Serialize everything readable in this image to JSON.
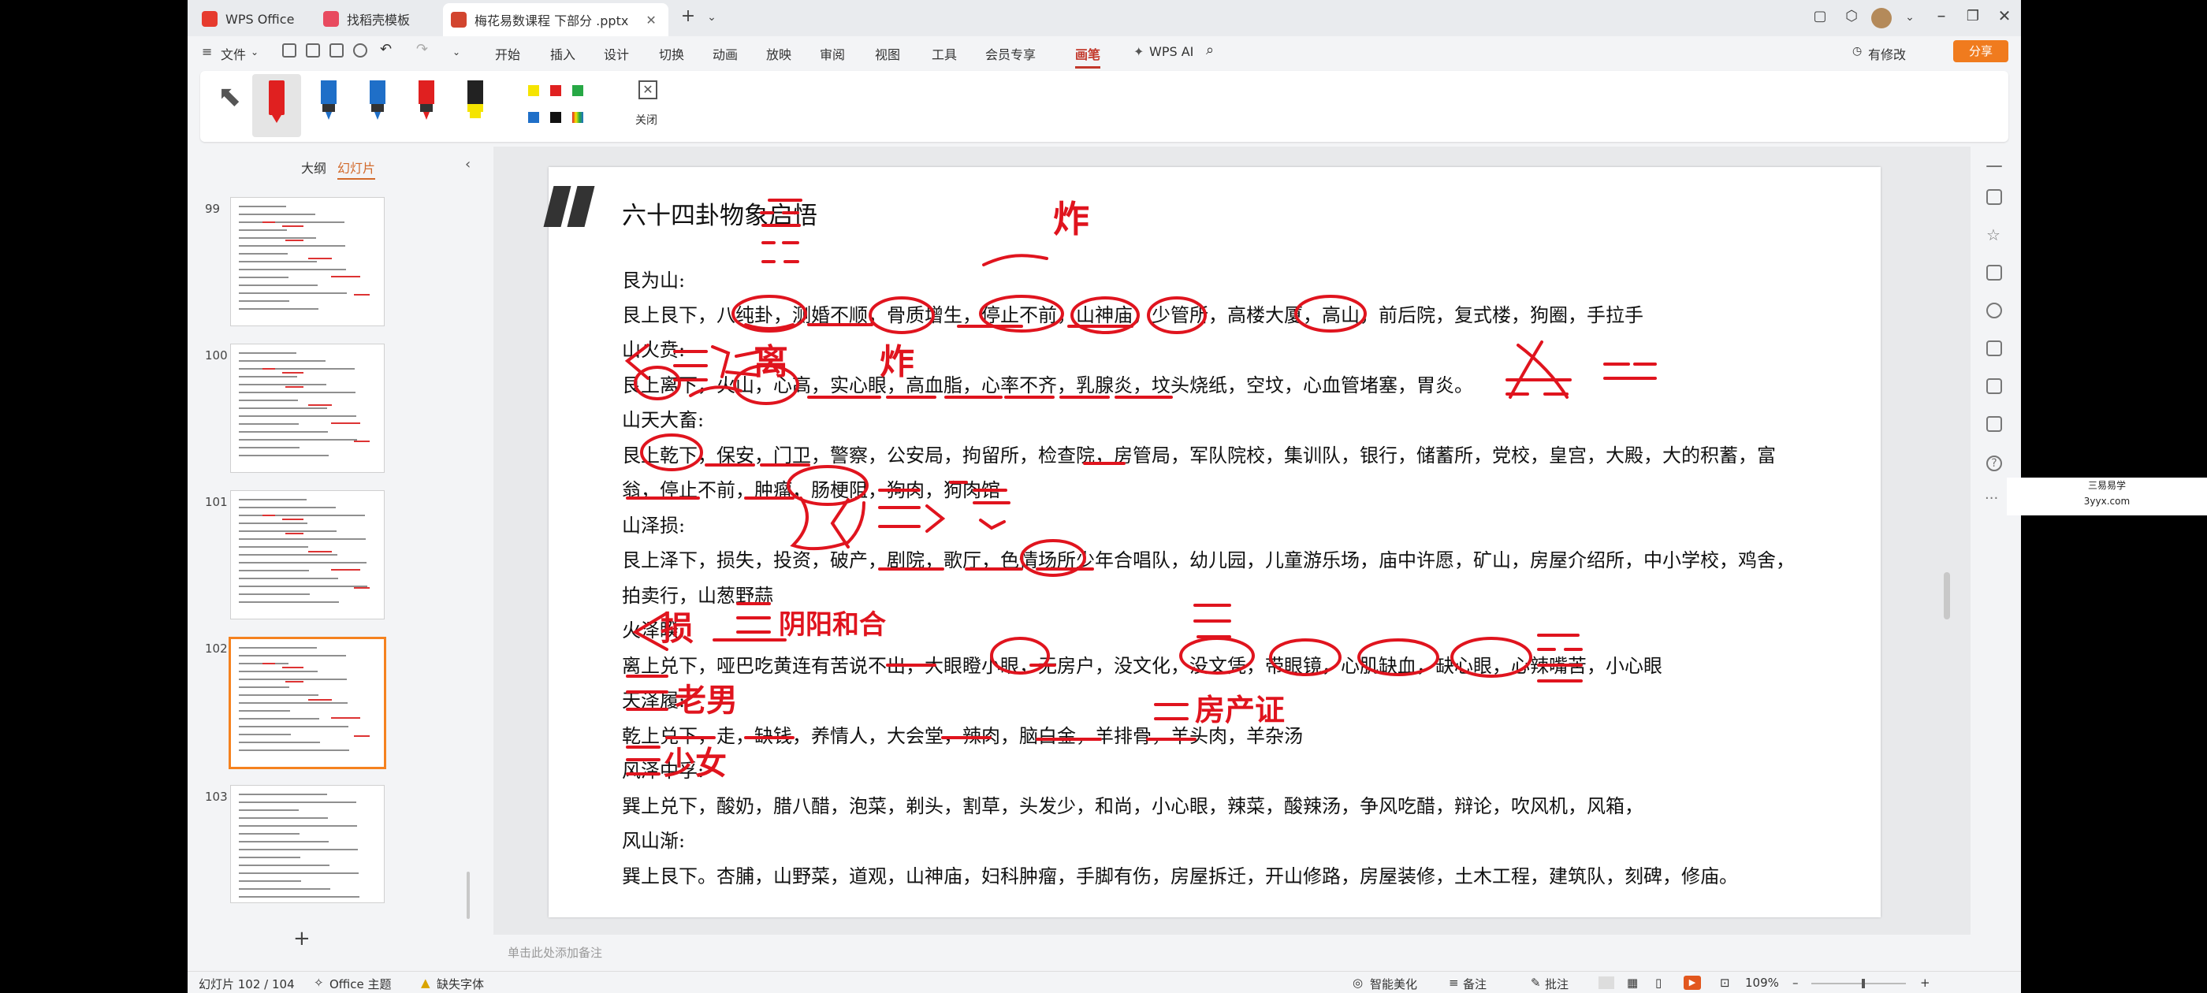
{
  "titlebar": {
    "tabs": [
      {
        "label": "WPS Office"
      },
      {
        "label": "找稻壳模板"
      },
      {
        "label": "梅花易数课程 下部分 .pptx"
      }
    ]
  },
  "menu": {
    "file_label": "文件",
    "items": [
      "开始",
      "插入",
      "设计",
      "切换",
      "动画",
      "放映",
      "审阅",
      "视图",
      "工具",
      "会员专享",
      "画笔"
    ],
    "active_item": "画笔",
    "ai_label": "WPS AI",
    "modified_label": "有修改",
    "share_label": "分享"
  },
  "ribbon": {
    "close_label": "关闭",
    "colors": [
      "#f5e400",
      "#e02020",
      "#27a845",
      "#1f6fc8",
      "#111111"
    ]
  },
  "left_panel": {
    "tab_outline": "大纲",
    "tab_slides": "幻灯片",
    "slide_numbers": [
      "99",
      "100",
      "101",
      "102",
      "103"
    ],
    "add_label": "+"
  },
  "slide": {
    "title": "六十四卦物象启悟",
    "lines": [
      "艮为山:",
      "艮上艮下，八纯卦，测婚不顺，骨质增生，停止不前，山神庙，少管所，高楼大厦，高山，前后院，复式楼，狗圈，手拉手",
      "山火贲:",
      "艮上离下，火山，心高，实心眼，高血脂，心率不齐，乳腺炎，坟头烧纸，空坟，心血管堵塞，胃炎。",
      "山天大畜:",
      "艮上乾下，保安，门卫，警察，公安局，拘留所，检查院，房管局，军队院校，集训队，银行，储蓄所，党校，皇宫，大殿，大的积蓄，富",
      "翁，停止不前，肿瘤，肠梗阻，狗肉，狗肉馆",
      "山泽损:",
      "艮上泽下，损失，投资，破产，剧院，歌厅，色情场所少年合唱队，幼儿园，儿童游乐场，庙中许愿，矿山，房屋介绍所，中小学校，鸡舍，",
      "拍卖行，山葱野蒜",
      "火泽睽:",
      "离上兑下，哑巴吃黄连有苦说不出，大眼瞪小眼，无房户，没文化，没文凭，带眼镜，心肌缺血，缺心眼，心辣嘴苦，小心眼",
      "天泽履:",
      "乾上兑下，走，缺钱，养情人，大会堂，辣肉，脑白金，羊排骨，羊头肉，羊杂汤",
      "风泽中孚:",
      "巽上兑下，酸奶，腊八醋，泡菜，剃头，割草，头发少，和尚，小心眼，辣菜，酸辣汤，争风吃醋，辩论，吹风机，风箱，",
      "风山渐:",
      "巽上艮下。杏脯，山野菜，道观，山神庙，妇科肿瘤，手脚有伤，房屋拆迁，开山修路，房屋装修，土木工程，建筑队，刻碑，修庙。"
    ],
    "handwriting": [
      "炸",
      "离",
      "炸",
      "损",
      "阴阳和合",
      "老男",
      "房产证",
      "少女"
    ]
  },
  "notes_placeholder": "单击此处添加备注",
  "status": {
    "slide_counter": "幻灯片 102 / 104",
    "theme": "Office 主题",
    "missing_font": "缺失字体",
    "smart_beautify": "智能美化",
    "notes": "备注",
    "comments": "批注",
    "zoom": "109%"
  },
  "watermark": {
    "line1": "三易易学",
    "line2": "3yyx.com"
  }
}
